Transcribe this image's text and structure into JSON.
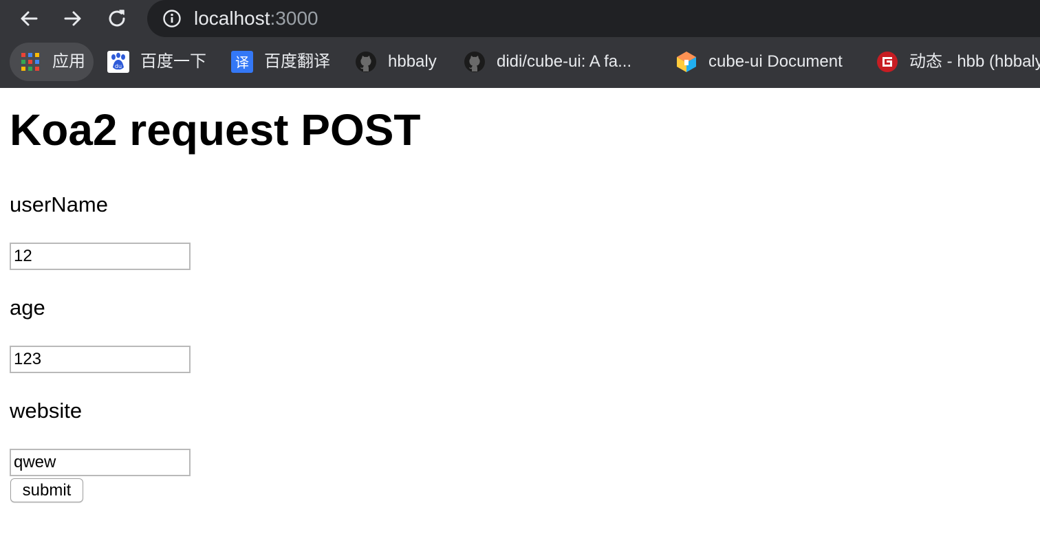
{
  "browser": {
    "address_bar": {
      "host": "localhost",
      "port": ":3000"
    },
    "nav_icons": [
      "back-arrow-icon",
      "forward-arrow-icon",
      "reload-icon"
    ],
    "bookmarks": [
      {
        "label": "应用",
        "icon": "apps-grid-icon"
      },
      {
        "label": "百度一下",
        "icon": "baidu-paw-icon"
      },
      {
        "label": "百度翻译",
        "icon": "baidu-translate-icon"
      },
      {
        "label": "hbbaly",
        "icon": "github-icon"
      },
      {
        "label": "didi/cube-ui: A fa...",
        "icon": "github-icon"
      },
      {
        "label": "cube-ui Document",
        "icon": "cube-ui-logo-icon"
      },
      {
        "label": "动态 - hbb (hbbaly",
        "icon": "gitee-logo-icon"
      }
    ],
    "colors": {
      "chrome": "#35363a",
      "omnibox": "#202124",
      "text": "#e8eaed",
      "muted_text": "#9aa0a6"
    }
  },
  "page": {
    "title": "Koa2 request POST",
    "form": {
      "fields": [
        {
          "label": "userName",
          "value": "12"
        },
        {
          "label": "age",
          "value": "123"
        },
        {
          "label": "website",
          "value": "qwew"
        }
      ],
      "submit_label": "submit"
    }
  }
}
